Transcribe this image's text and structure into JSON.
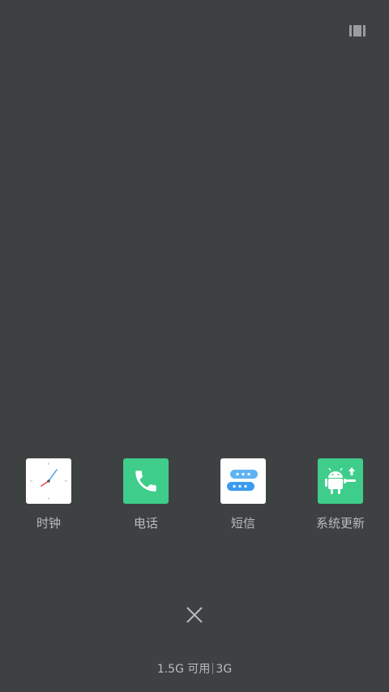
{
  "colors": {
    "background": "#3e4142",
    "label_text": "#b9bcbd",
    "green_icon_bg": "#3fcd8c",
    "white_icon_bg": "#ffffff",
    "message_bubble": "#3c9bf0"
  },
  "header": {
    "layout_toggle_icon": "layout-toggle-icon"
  },
  "recent_apps": [
    {
      "label": "时钟",
      "icon": "clock-icon"
    },
    {
      "label": "电话",
      "icon": "phone-icon"
    },
    {
      "label": "短信",
      "icon": "message-icon"
    },
    {
      "label": "系统更新",
      "icon": "android-update-icon"
    }
  ],
  "close_all": {
    "icon": "close-icon"
  },
  "memory": {
    "free_text": "1.5G 可用",
    "total_text": "3G"
  }
}
